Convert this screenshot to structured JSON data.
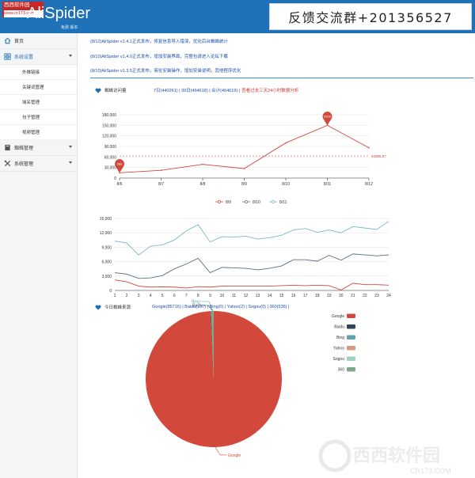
{
  "site_badge": {
    "name": "西西软件园",
    "url": "www.cr173.com"
  },
  "app": {
    "logo": "AliSpider",
    "edition": "免费 版本"
  },
  "banner": {
    "text": "反馈交流群+201356527"
  },
  "sidebar": {
    "items": [
      {
        "label": "首页",
        "icon": "home-icon"
      },
      {
        "label": "系统设置",
        "icon": "grid-icon"
      },
      {
        "label": "蜘蛛管理",
        "icon": "book-icon"
      },
      {
        "label": "系统管理",
        "icon": "tools-icon"
      }
    ],
    "sub_items": [
      "外推链接",
      "关键词管理",
      "域名管理",
      "句子管理",
      "视频管理"
    ]
  },
  "notices": [
    "(8/12)AliSpider v1.4.1正式发布，修复信息导入错误，优化后台蜘蛛统计",
    "(8/10)AliSpider v1.4.0正式发布，增加安装界面，完整包请进入论坛下载",
    "(8/10)AliSpider v1.3.5正式发布，简化安装操作，增加安装说明，其他程序优化"
  ],
  "visits": {
    "title": "蜘蛛访问量",
    "links": "7日(440261) | 30日(464618) | 合计(464619) |",
    "alert": "查看过去三天24小时数据分析"
  },
  "sources": {
    "title": "今日蜘蛛来源",
    "links": "Google(85716) | Baidu(107) | Bing(0) | Yahoo(2) | Sogou(0) | 360(536) |"
  },
  "colors": {
    "header": "#1f72b8",
    "accent": "#d0342c",
    "google": "#d2483a",
    "baidu": "#2f4653",
    "bing": "#5fa4aa",
    "yahoo": "#d89b7e",
    "sogou": "#9ed2c3",
    "s360": "#7fa88b"
  },
  "chart_data": [
    {
      "type": "line",
      "x": [
        "8/6",
        "8/7",
        "8/8",
        "8/9",
        "8/10",
        "8/11",
        "8/12"
      ],
      "series": [
        {
          "values": [
            15000,
            22000,
            39000,
            27000,
            100000,
            150000,
            86000
          ]
        }
      ],
      "ylim": [
        0,
        180000
      ],
      "yticks": [
        "0",
        "30,000",
        "60,000",
        "90,000",
        "120,000",
        "150,000",
        "180,000"
      ],
      "max_label": "5200",
      "min_label": "580",
      "average_label": "62895.57",
      "average_value": 62895.57,
      "grid": true
    },
    {
      "type": "line",
      "x": [
        "1",
        "2",
        "3",
        "4",
        "5",
        "6",
        "7",
        "8",
        "9",
        "10",
        "11",
        "12",
        "13",
        "14",
        "15",
        "16",
        "17",
        "18",
        "19",
        "20",
        "21",
        "22",
        "23",
        "24"
      ],
      "series": [
        {
          "name": "8/9",
          "color": "#d2483a",
          "values": [
            2200,
            1800,
            900,
            700,
            750,
            700,
            500,
            800,
            700,
            900,
            900,
            900,
            900,
            900,
            1000,
            1100,
            1000,
            1100,
            1000,
            100,
            1500,
            1200,
            1200,
            1100
          ]
        },
        {
          "name": "8/10",
          "color": "#5b6f79",
          "values": [
            3700,
            3400,
            2500,
            2600,
            3100,
            4500,
            5500,
            6700,
            3700,
            4800,
            4700,
            4600,
            4300,
            4600,
            5100,
            6400,
            6400,
            6100,
            7300,
            6300,
            7600,
            7400,
            7200,
            7400
          ]
        },
        {
          "name": "8/11",
          "color": "#78b8c2",
          "values": [
            10300,
            9900,
            7400,
            9200,
            9500,
            10500,
            12400,
            13700,
            10100,
            11200,
            11100,
            11300,
            10700,
            11000,
            11500,
            12600,
            12900,
            12100,
            12600,
            12000,
            13300,
            13000,
            12700,
            14400
          ]
        }
      ],
      "ylim": [
        0,
        15000
      ],
      "yticks": [
        "0",
        "3,000",
        "6,000",
        "9,000",
        "12,000",
        "15,000"
      ],
      "legend": "top-center",
      "grid": true
    },
    {
      "type": "pie",
      "slices": [
        {
          "name": "Google",
          "value": 85716
        },
        {
          "name": "Baidu",
          "value": 107
        },
        {
          "name": "Bing",
          "value": 0
        },
        {
          "name": "Yahoo",
          "value": 2
        },
        {
          "name": "Sogou",
          "value": 0
        },
        {
          "name": "360",
          "value": 536
        }
      ],
      "legend": "right",
      "callout_labels": [
        "Google",
        "Baidu",
        "Bing"
      ]
    }
  ],
  "watermark": {
    "text": "西西软件园",
    "url": "CR173.COM"
  }
}
